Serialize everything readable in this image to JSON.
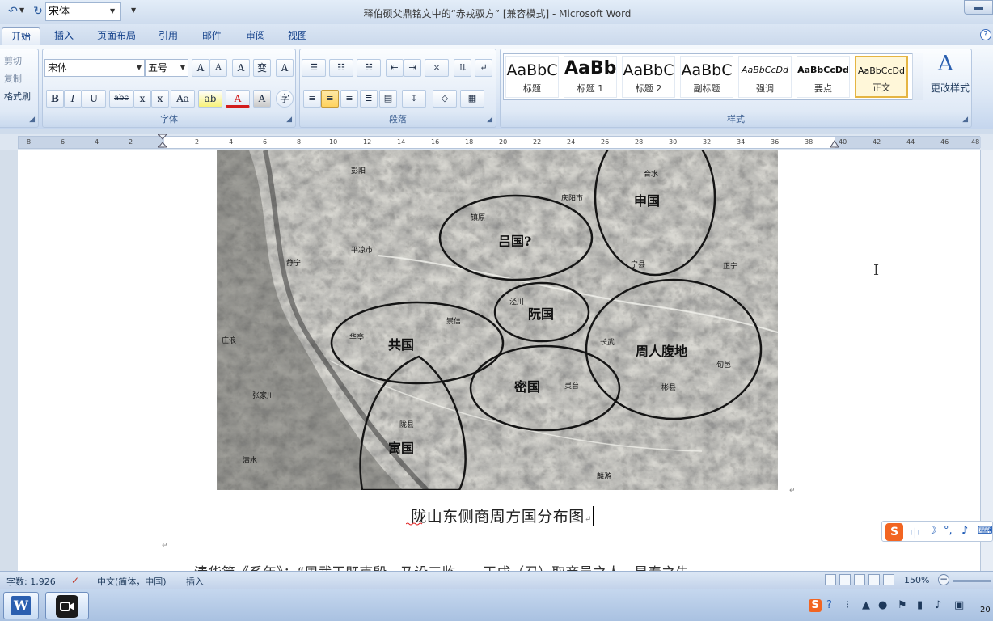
{
  "window": {
    "title": "释伯硕父鼎铭文中的“赤戎驭方” [兼容模式] - Microsoft Word"
  },
  "qat": {
    "font_value": "宋体"
  },
  "tabs": [
    "开始",
    "插入",
    "页面布局",
    "引用",
    "邮件",
    "审阅",
    "视图"
  ],
  "help_glyph": "?",
  "clipboard": {
    "cut": "剪切",
    "copy": "复制",
    "format_painter": "格式刷"
  },
  "font_group": {
    "label": "字体",
    "font_name": "宋体",
    "font_size": "五号",
    "buttons": {
      "grow": "A",
      "shrink": "A",
      "clear": "A",
      "phonetic": "变",
      "border": "A",
      "bold": "B",
      "italic": "I",
      "underline": "U",
      "strike": "abc",
      "sub": "x",
      "sup": "x",
      "case": "Aa",
      "highlight": "ab",
      "color": "A",
      "shade": "A",
      "enclose": "字"
    }
  },
  "paragraph_group": {
    "label": "段落"
  },
  "styles_group": {
    "label": "样式",
    "change_styles": "更改样式",
    "items": [
      {
        "sample": "AaBbC",
        "name": "标题"
      },
      {
        "sample": "AaBb",
        "name": "标题 1"
      },
      {
        "sample": "AaBbC",
        "name": "标题 2"
      },
      {
        "sample": "AaBbC",
        "name": "副标题"
      },
      {
        "sample": "AaBbCcDd",
        "name": "强调"
      },
      {
        "sample": "AaBbCcDd",
        "name": "要点"
      },
      {
        "sample": "AaBbCcDd",
        "name": "正文"
      }
    ]
  },
  "ruler": {
    "left_labels": [
      "8",
      "6",
      "4",
      "2"
    ],
    "labels": [
      "2",
      "4",
      "6",
      "8",
      "10",
      "12",
      "14",
      "16",
      "18",
      "20",
      "22",
      "24",
      "26",
      "28",
      "30",
      "32",
      "34",
      "36",
      "38",
      "40",
      "42",
      "44",
      "46",
      "48"
    ]
  },
  "document": {
    "map_labels": {
      "lu": "吕国?",
      "shen": "申国",
      "ruan": "阮国",
      "zhou": "周人腹地",
      "mi": "密国",
      "yu": "寓国",
      "gong": "共国",
      "qingyang": "庆阳市",
      "pingliang": "平凉市",
      "pengyang": "彭阳",
      "heshui": "合水",
      "jingchuan": "泾川",
      "changwu": "长武",
      "binxian": "彬县",
      "xunyi": "旬邑",
      "ningxian": "宁县",
      "zhengning": "正宁",
      "lingtai": "灵台",
      "chongxin": "崇信",
      "huating": "华亭",
      "zhangjiachuan": "张家川",
      "longxian": "陇县",
      "qingshui": "清水",
      "zhuanglang": "庄浪",
      "jingning": "静宁",
      "linyou": "麟游",
      "zhenyuan": "镇原",
      "huachi": "华池"
    },
    "caption": "陇山东侧商周方国分布图",
    "body_text": "清华简《系年》：“周武王既克殷，乃设三监……王成（召）取商邑之人，是秦之先。"
  },
  "ime": {
    "logo": "S",
    "mode": "中",
    "moon": "☽",
    "punct": "°,",
    "mic": "♪",
    "keyboard": "⌨"
  },
  "status": {
    "word_count": "字数: 1,926",
    "language": "中文(简体，中国)",
    "insert_mode": "插入",
    "zoom": "150%"
  },
  "taskbar": {
    "word_letter": "W",
    "clock": "20"
  },
  "colors": {
    "ribbon": "#dce7f5",
    "title_bg": "#cedcee",
    "accent": "#15428b",
    "ime_orange": "#f26522"
  }
}
